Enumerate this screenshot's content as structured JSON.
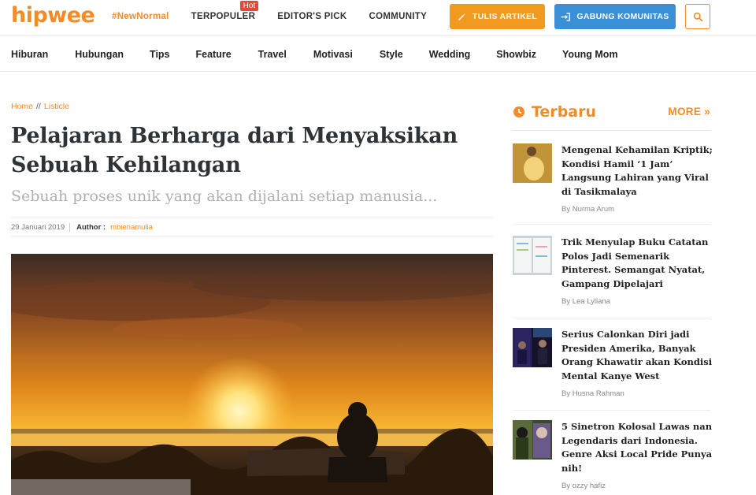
{
  "header": {
    "logo": "hipwee",
    "nav": [
      {
        "label": "#NewNormal"
      },
      {
        "label": "TERPOPULER",
        "badge": "Hot"
      },
      {
        "label": "EDITOR'S PICK"
      },
      {
        "label": "COMMUNITY"
      }
    ],
    "tulis_label": "TULIS ARTIKEL",
    "gabung_label": "GABUNG KOMUNITAS"
  },
  "categories": [
    "Hiburan",
    "Hubungan",
    "Tips",
    "Feature",
    "Travel",
    "Motivasi",
    "Style",
    "Wedding",
    "Showbiz",
    "Young Mom"
  ],
  "article": {
    "breadcrumb": [
      "Home",
      "Listicle"
    ],
    "breadcrumb_sep": "//",
    "title": "Pelajaran Berharga dari Menyaksikan Sebuah Kehilangan",
    "subtitle": "Sebuah proses unik yang akan dijalani setiap manusia...",
    "date": "29 Januari 2019",
    "author_label": "Author :",
    "author": "mbienamulia"
  },
  "sidebar": {
    "heading": "Terbaru",
    "more": "MORE",
    "items": [
      {
        "title": "Mengenal Kehamilan Kriptik; Kondisi Hamil ‘1 Jam’ Langsung Lahiran yang Viral di Tasikmalaya",
        "by": "By Nurma Arum"
      },
      {
        "title": "Trik Menyulap Buku Catatan Polos Jadi Semenarik Pinterest. Semangat Nyatat, Gampang Dipelajari",
        "by": "By Lea Lyliana"
      },
      {
        "title": "Serius Calonkan Diri jadi Presiden Amerika, Banyak Orang Khawatir akan Kondisi Mental Kanye West",
        "by": "By Husna Rahman"
      },
      {
        "title": "5 Sinetron Kolosal Lawas nan Legendaris dari Indonesia. Genre Aksi Local Pride Punya nih!",
        "by": "By ozzy hafiz"
      }
    ]
  },
  "colors": {
    "brand": "#f28c28",
    "tulis": "#f29a1f",
    "gabung": "#3b8fd6"
  }
}
